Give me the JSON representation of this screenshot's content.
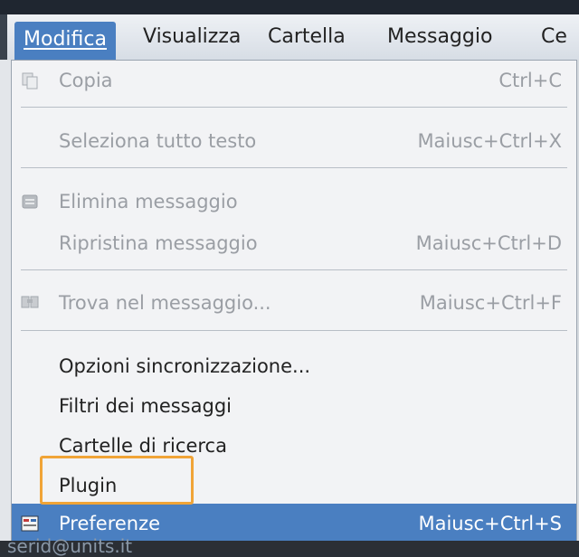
{
  "menubar": {
    "items": [
      {
        "label": "Modifica",
        "active": true
      },
      {
        "label": "Visualizza"
      },
      {
        "label": "Cartella"
      },
      {
        "label": "Messaggio"
      },
      {
        "label": "Ce"
      }
    ]
  },
  "dropdown": {
    "items": [
      {
        "label": "Copia",
        "shortcut": "Ctrl+C",
        "disabled": true,
        "icon": "copy-icon"
      },
      {
        "label": "Seleziona tutto testo",
        "shortcut": "Maiusc+Ctrl+X",
        "disabled": true
      },
      {
        "label": "Elimina messaggio",
        "shortcut": "",
        "disabled": true,
        "icon": "trash-icon"
      },
      {
        "label": "Ripristina messaggio",
        "shortcut": "Maiusc+Ctrl+D",
        "disabled": true
      },
      {
        "label": "Trova nel messaggio...",
        "shortcut": "Maiusc+Ctrl+F",
        "disabled": true,
        "icon": "find-icon"
      },
      {
        "label": "Opzioni sincronizzazione...",
        "shortcut": ""
      },
      {
        "label": "Filtri dei messaggi",
        "shortcut": ""
      },
      {
        "label": "Cartelle di ricerca",
        "shortcut": ""
      },
      {
        "label": "Plugin",
        "shortcut": ""
      },
      {
        "label": "Preferenze",
        "shortcut": "Maiusc+Ctrl+S",
        "selected": true,
        "icon": "preferences-icon"
      }
    ]
  },
  "bottom": {
    "text": "serid@units.it"
  },
  "colors": {
    "accent": "#4a7fc1",
    "highlight_box": "#f0a437",
    "disabled_text": "#9a9ea4",
    "menu_bg": "#f2f3f5"
  }
}
